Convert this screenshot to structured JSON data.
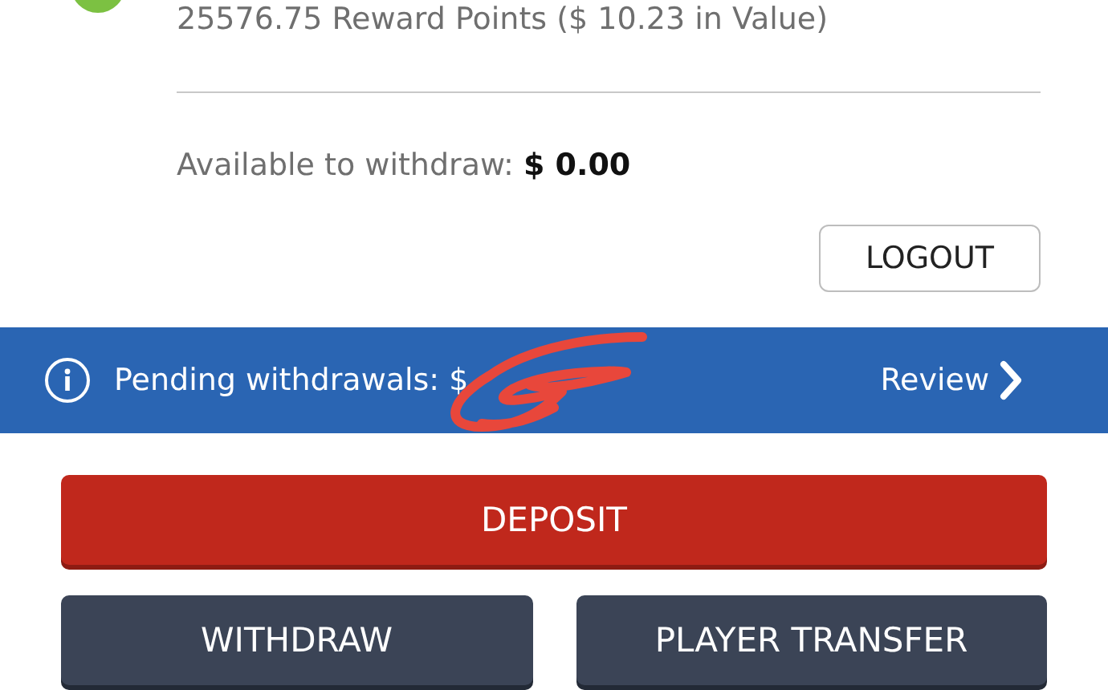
{
  "account": {
    "reward_points": "25576.75 Reward Points ($ 10.23 in Value)",
    "available_label": "Available to withdraw:",
    "available_amount": "$ 0.00"
  },
  "logout_button": "LOGOUT",
  "pending_banner": {
    "text": "Pending withdrawals: $",
    "link": "Review"
  },
  "buttons": [
    {
      "label": "DEPOSIT",
      "kind": "primary"
    },
    {
      "label": "WITHDRAW",
      "kind": "secondary"
    },
    {
      "label": "PLAYER TRANSFER",
      "kind": "secondary"
    }
  ]
}
